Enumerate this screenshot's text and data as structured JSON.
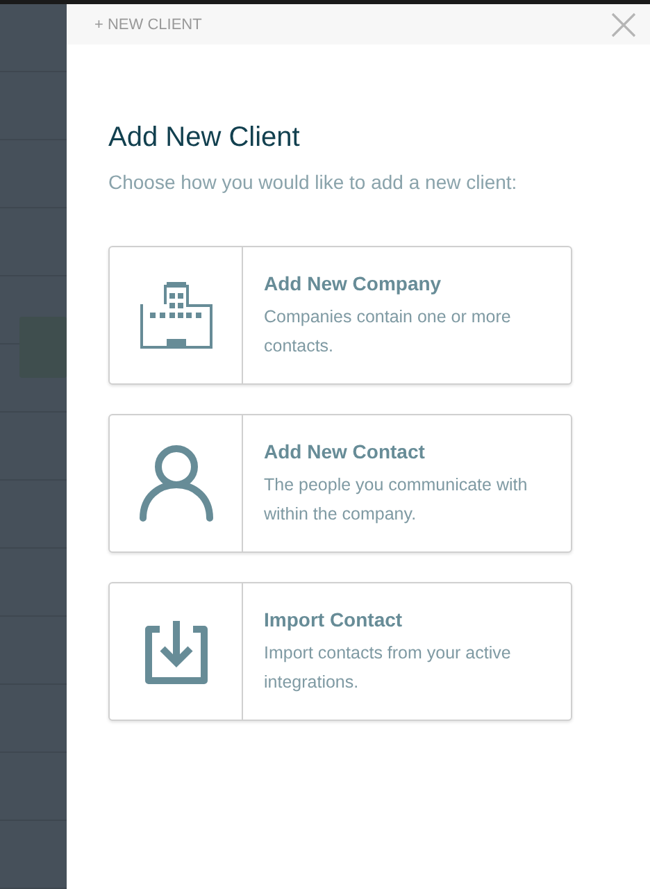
{
  "header": {
    "label": "+ NEW CLIENT"
  },
  "title": "Add New Client",
  "subtitle": "Choose how you would like to add a new client:",
  "options": [
    {
      "kind": "company",
      "title": "Add New Company",
      "description": "Companies contain one or more contacts."
    },
    {
      "kind": "contact",
      "title": "Add New Contact",
      "description": "The people you communicate with within the company."
    },
    {
      "kind": "import",
      "title": "Import Contact",
      "description": "Import contacts from your active integrations."
    }
  ]
}
